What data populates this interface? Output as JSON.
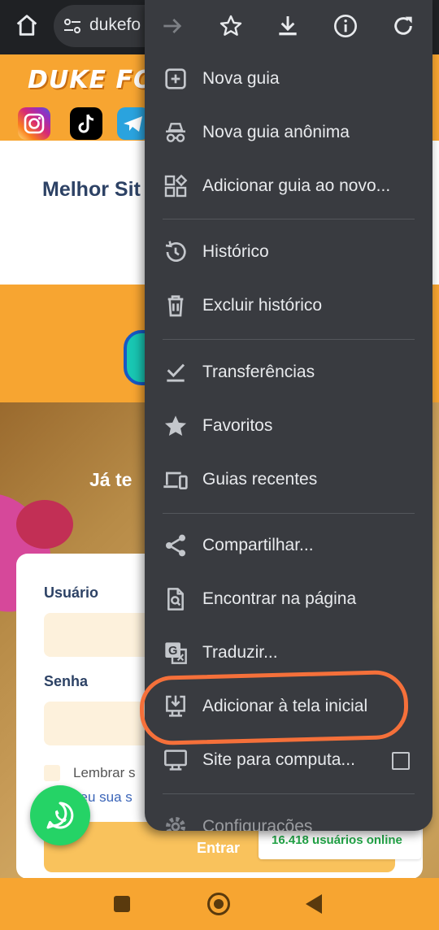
{
  "browser": {
    "url_text": "dukefo"
  },
  "page": {
    "logo_text": "DUKE FO",
    "hero_title": "Melhor Sit",
    "welcome_text": "Já te",
    "login": {
      "username_label": "Usuário",
      "password_label": "Senha",
      "remember_label": "Lembrar s",
      "forgot_label": "ceu sua s",
      "submit_label": "Entrar"
    },
    "online_badge": "16.418 usuários online"
  },
  "menu": {
    "items": [
      {
        "label": "Nova guia",
        "icon": "plus-box-icon"
      },
      {
        "label": "Nova guia anônima",
        "icon": "incognito-icon"
      },
      {
        "label": "Adicionar guia ao novo...",
        "icon": "add-to-group-icon"
      },
      {
        "label": "Histórico",
        "icon": "history-icon"
      },
      {
        "label": "Excluir histórico",
        "icon": "trash-icon"
      },
      {
        "label": "Transferências",
        "icon": "download-check-icon"
      },
      {
        "label": "Favoritos",
        "icon": "star-filled-icon"
      },
      {
        "label": "Guias recentes",
        "icon": "devices-icon"
      },
      {
        "label": "Compartilhar...",
        "icon": "share-icon"
      },
      {
        "label": "Encontrar na página",
        "icon": "find-in-page-icon"
      },
      {
        "label": "Traduzir...",
        "icon": "translate-icon"
      },
      {
        "label": "Adicionar à tela inicial",
        "icon": "add-to-home-icon"
      },
      {
        "label": "Site para computa...",
        "icon": "desktop-icon"
      },
      {
        "label": "Configurações",
        "icon": "settings-icon"
      }
    ],
    "desktop_site_checked": false
  },
  "annotation": {
    "highlight_color": "#f5703a"
  }
}
